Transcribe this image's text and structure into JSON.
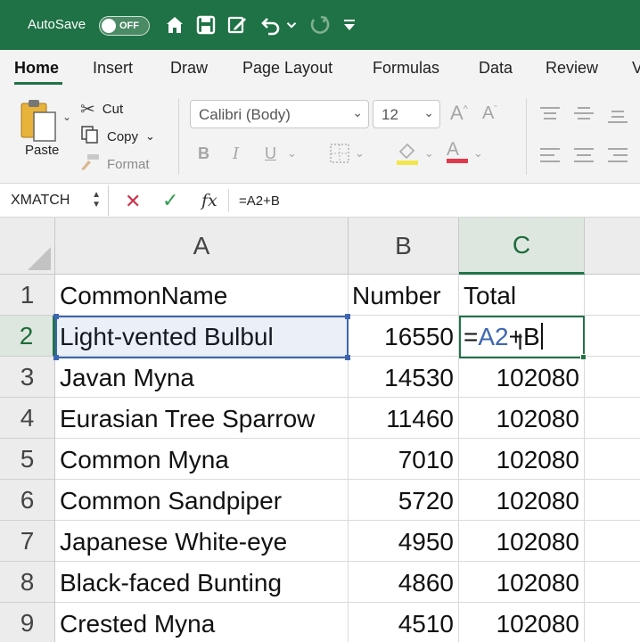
{
  "titlebar": {
    "autosave_label": "AutoSave",
    "autosave_state": "OFF",
    "icons": [
      "home-icon",
      "save-icon",
      "edit-doc-icon",
      "undo-icon",
      "redo-icon",
      "customize-icon"
    ]
  },
  "ribbon": {
    "tabs": [
      {
        "label": "Home",
        "active": true
      },
      {
        "label": "Insert"
      },
      {
        "label": "Draw"
      },
      {
        "label": "Page Layout"
      },
      {
        "label": "Formulas"
      },
      {
        "label": "Data"
      },
      {
        "label": "Review"
      },
      {
        "label": "V"
      }
    ],
    "clipboard": {
      "paste": "Paste",
      "cut": "Cut",
      "copy": "Copy",
      "format": "Format"
    },
    "font": {
      "name": "Calibri (Body)",
      "size": "12",
      "bold": "B",
      "italic": "I",
      "underline": "U",
      "font_color_letter": "A"
    }
  },
  "formula_bar": {
    "name_box": "XMATCH",
    "formula": "=A2+B"
  },
  "sheet": {
    "columns": [
      "A",
      "B",
      "C"
    ],
    "active_column": "C",
    "active_row": "2",
    "header_row": {
      "row": "1",
      "A": "CommonName",
      "B": "Number",
      "C": "Total"
    },
    "editing": {
      "row": "2",
      "A": "Light-vented Bulbul",
      "B": "16550",
      "C_prefix": "=",
      "C_ref": "A2",
      "C_suffix": "+B"
    },
    "rows": [
      {
        "row": "3",
        "A": "Javan Myna",
        "B": "14530",
        "C": "102080"
      },
      {
        "row": "4",
        "A": "Eurasian Tree Sparrow",
        "B": "11460",
        "C": "102080"
      },
      {
        "row": "5",
        "A": "Common Myna",
        "B": "7010",
        "C": "102080"
      },
      {
        "row": "6",
        "A": "Common Sandpiper",
        "B": "5720",
        "C": "102080"
      },
      {
        "row": "7",
        "A": "Japanese White-eye",
        "B": "4950",
        "C": "102080"
      },
      {
        "row": "8",
        "A": "Black-faced Bunting",
        "B": "4860",
        "C": "102080"
      },
      {
        "row": "9",
        "A": "Crested Myna",
        "B": "4510",
        "C": "102080"
      }
    ]
  },
  "colors": {
    "brand": "#1f7245",
    "ref_blue": "#3d66b0",
    "cancel_red": "#c8334a",
    "enter_green": "#2e9a4d"
  }
}
